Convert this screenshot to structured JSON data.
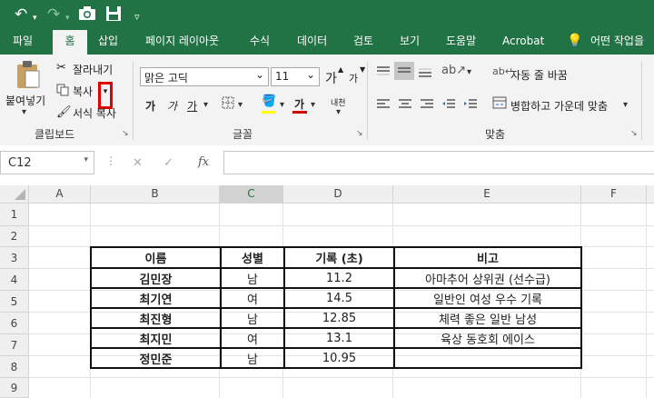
{
  "quick_access": {
    "icons": [
      "undo-icon",
      "redo-icon",
      "camera-icon",
      "save-icon",
      "customize-icon"
    ]
  },
  "tabs": [
    "파일",
    "홈",
    "삽입",
    "페이지 레이아웃",
    "수식",
    "데이터",
    "검토",
    "보기",
    "도움말",
    "Acrobat",
    "어떤 작업을"
  ],
  "active_tab": "홈",
  "clipboard": {
    "paste": "붙여넣기",
    "cut": "잘라내기",
    "copy": "복사",
    "format_painter": "서식 복사",
    "group": "클립보드"
  },
  "font": {
    "family": "맑은 고딕",
    "size": "11",
    "grow": "가",
    "shrink": "가",
    "bold": "가",
    "italic": "가",
    "underline": "가",
    "font_color": "가",
    "phonetic": "내천",
    "group": "글꼴"
  },
  "alignment": {
    "wrap": "자동 줄 바꿈",
    "merge": "병합하고 가운데 맞춤",
    "group": "맞춤"
  },
  "colors": {
    "brand": "#217346",
    "highlight": "#e00000",
    "font_underline": "#d00000",
    "fill_underline": "#ffff00"
  },
  "name_box": "C12",
  "formula_bar": {
    "cancel": "✕",
    "enter": "✓",
    "fx": "fx",
    "value": ""
  },
  "columns": [
    "A",
    "B",
    "C",
    "D",
    "E",
    "F"
  ],
  "rows": [
    "1",
    "2",
    "3",
    "4",
    "5",
    "6",
    "7",
    "8",
    "9"
  ],
  "selected_column": "C",
  "table": {
    "headers": [
      "이름",
      "성별",
      "기록 (초)",
      "비고"
    ],
    "rows": [
      [
        "김민장",
        "남",
        "11.2",
        "아마추어 상위권 (선수급)"
      ],
      [
        "최기연",
        "여",
        "14.5",
        "일반인 여성 우수 기록"
      ],
      [
        "최진형",
        "남",
        "12.85",
        "체력 좋은 일반 남성"
      ],
      [
        "최지민",
        "여",
        "13.1",
        "육상 동호회 에이스"
      ],
      [
        "정민준",
        "남",
        "10.95",
        ""
      ]
    ]
  }
}
